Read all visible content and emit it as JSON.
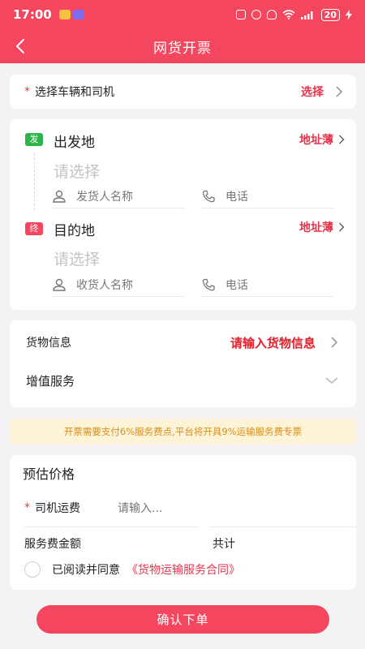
{
  "status_bar": {
    "time": "17:00",
    "battery": "20"
  },
  "nav": {
    "title": "网货开票"
  },
  "vehicle": {
    "required_mark": "*",
    "label": "选择车辆和司机",
    "action": "选择"
  },
  "address": {
    "origin": {
      "tag": "发",
      "title": "出发地",
      "book": "地址薄",
      "placeholder": "请选择",
      "name_placeholder": "发货人名称",
      "phone_placeholder": "电话"
    },
    "destination": {
      "tag": "终",
      "title": "目的地",
      "book": "地址薄",
      "placeholder": "请选择",
      "name_placeholder": "收货人名称",
      "phone_placeholder": "电话"
    }
  },
  "goods": {
    "label": "货物信息",
    "value": "请输入货物信息"
  },
  "value_added": {
    "label": "增值服务"
  },
  "notice": {
    "text": "开票需要支付6%服务费点,平台将开具9%运输服务费专票"
  },
  "price": {
    "title": "预估价格",
    "required_mark": "*",
    "freight_label": "司机运费",
    "freight_placeholder": "请输入...",
    "fee_label": "服务费金额",
    "total_label": "共计",
    "agree_text": "已阅读并同意",
    "contract": "《货物运输服务合同》"
  },
  "submit": {
    "label": "确认下单"
  },
  "colors": {
    "brand": "#f4475f",
    "origin_tag": "#2cb34a",
    "notice_bg": "#fdf3d6",
    "notice_text": "#d98f1f"
  }
}
